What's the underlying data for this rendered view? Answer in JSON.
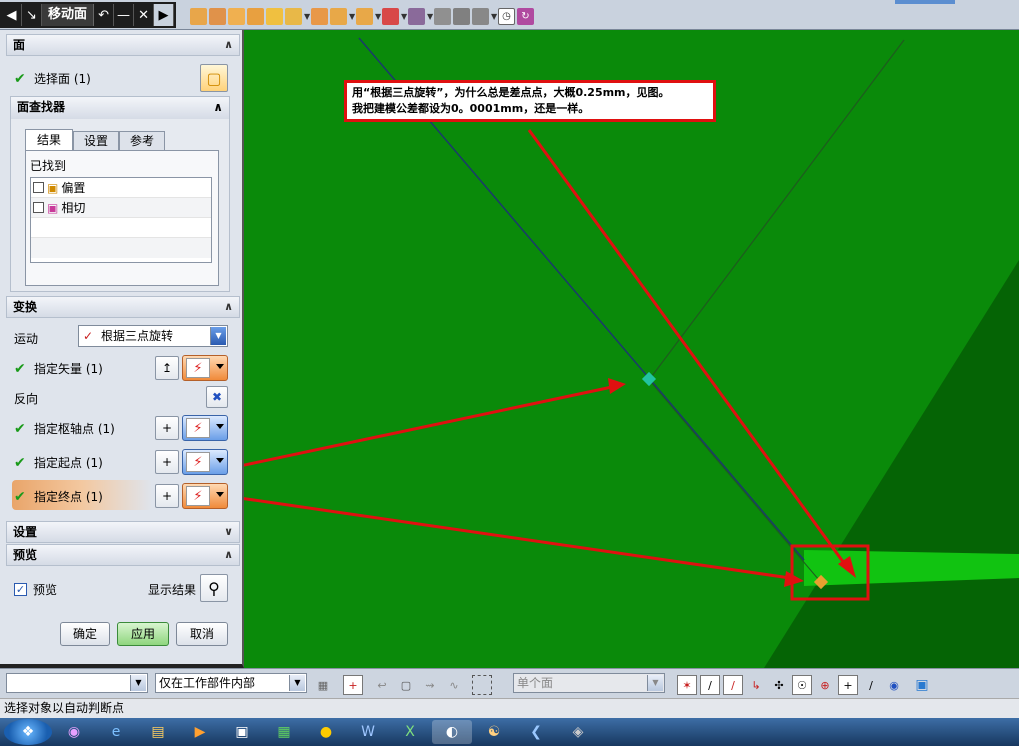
{
  "dialog": {
    "title": "移动面",
    "face_group": {
      "title": "面",
      "select_face": "选择面 (1)"
    },
    "finder": {
      "title": "面查找器",
      "tabs": [
        "结果",
        "设置",
        "参考"
      ],
      "found_label": "已找到",
      "items": [
        "偏置",
        "相切"
      ]
    },
    "transform": {
      "title": "变换",
      "motion_label": "运动",
      "motion_value": "根据三点旋转",
      "specify_vector": "指定矢量 (1)",
      "reverse": "反向",
      "pivot": "指定枢轴点 (1)",
      "start": "指定起点 (1)",
      "end": "指定终点 (1)"
    },
    "settings": {
      "title": "设置"
    },
    "preview": {
      "title": "预览",
      "checkbox": "预览",
      "show_result": "显示结果"
    },
    "buttons": {
      "ok": "确定",
      "apply": "应用",
      "cancel": "取消"
    }
  },
  "annotation": {
    "line1": "用“根据三点旋转”，为什么总是差点点，大概0.25mm，见图。",
    "line2": "我把建模公差都设为0。0001mm，还是一样。"
  },
  "bottom_toolbar": {
    "filter_scope": "仅在工作部件内部",
    "face_rule": "单个面"
  },
  "status": {
    "text": "选择对象以自动判断点"
  },
  "colors": {
    "viewport": "#0a8a0a",
    "annotation_border": "#e01010",
    "arrow": "#e01010"
  }
}
